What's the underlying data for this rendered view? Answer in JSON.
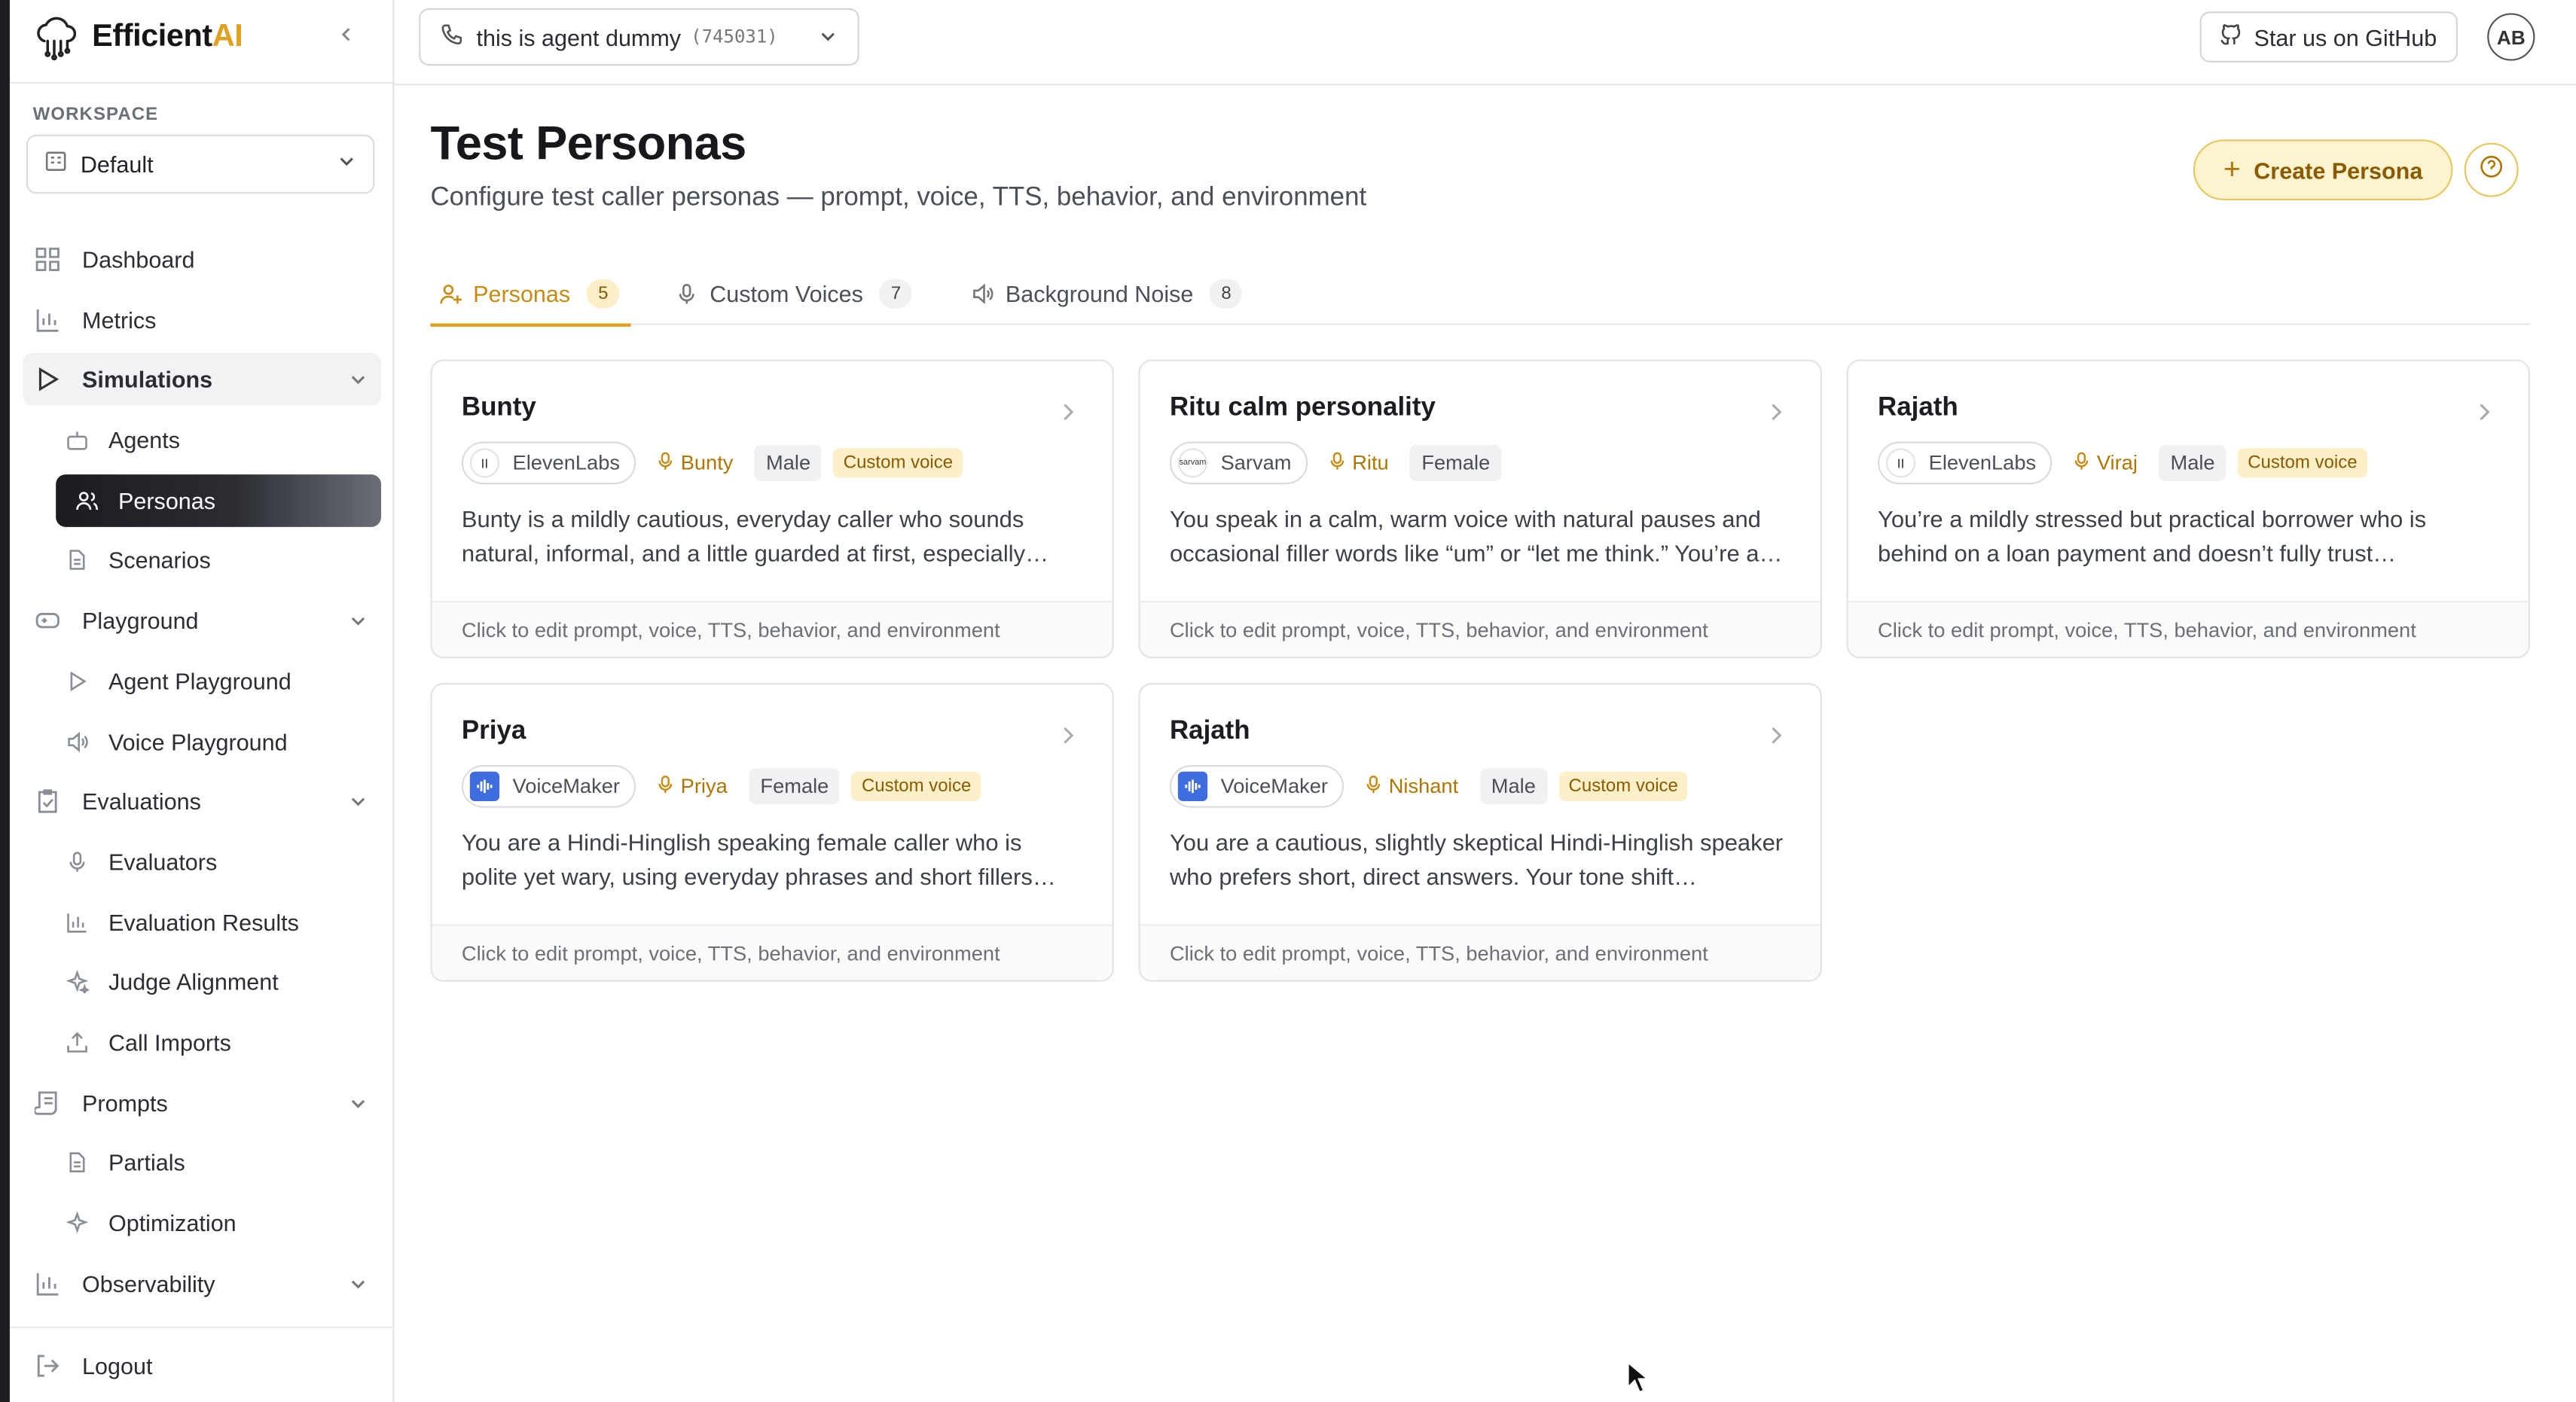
{
  "brand": {
    "name_main": "Efficient",
    "name_accent": "AI"
  },
  "workspace": {
    "label": "WORKSPACE",
    "selected": "Default"
  },
  "sidebar": {
    "items": [
      {
        "label": "Dashboard",
        "icon": "dashboard-icon"
      },
      {
        "label": "Metrics",
        "icon": "bar-chart-icon"
      },
      {
        "label": "Simulations",
        "icon": "play-icon"
      },
      {
        "label": "Agents",
        "icon": "bot-icon"
      },
      {
        "label": "Personas",
        "icon": "users-icon"
      },
      {
        "label": "Scenarios",
        "icon": "file-icon"
      },
      {
        "label": "Playground",
        "icon": "gamepad-icon"
      },
      {
        "label": "Agent Playground",
        "icon": "play-icon"
      },
      {
        "label": "Voice Playground",
        "icon": "speaker-icon"
      },
      {
        "label": "Evaluations",
        "icon": "clipboard-check-icon"
      },
      {
        "label": "Evaluators",
        "icon": "mic-icon"
      },
      {
        "label": "Evaluation Results",
        "icon": "bar-chart-icon"
      },
      {
        "label": "Judge Alignment",
        "icon": "sparkle-icon"
      },
      {
        "label": "Call Imports",
        "icon": "upload-icon"
      },
      {
        "label": "Prompts",
        "icon": "scroll-icon"
      },
      {
        "label": "Partials",
        "icon": "file-icon"
      },
      {
        "label": "Optimization",
        "icon": "sparkle-icon"
      },
      {
        "label": "Observability",
        "icon": "bar-chart-icon"
      }
    ],
    "logout": "Logout"
  },
  "topbar": {
    "agent_name": "this is agent dummy",
    "agent_id": "(745031)",
    "github_label": "Star us on GitHub",
    "avatar_initials": "AB"
  },
  "page": {
    "title": "Test Personas",
    "subtitle": "Configure test caller personas — prompt, voice, TTS, behavior, and environment",
    "create_label": "Create Persona"
  },
  "tabs": [
    {
      "label": "Personas",
      "count": "5"
    },
    {
      "label": "Custom Voices",
      "count": "7"
    },
    {
      "label": "Background Noise",
      "count": "8"
    }
  ],
  "cards": [
    {
      "title": "Bunty",
      "provider": "ElevenLabs",
      "voice": "Bunty",
      "gender": "Male",
      "custom": "Custom voice",
      "desc": "Bunty is a mildly cautious, everyday caller who sounds natural, informal, and a little guarded at first, especially…",
      "footer": "Click to edit prompt, voice, TTS, behavior, and environment"
    },
    {
      "title": "Ritu calm personality",
      "provider": "Sarvam",
      "voice": "Ritu",
      "gender": "Female",
      "custom": "",
      "desc": "You speak in a calm, warm voice with natural pauses and occasional filler words like “um” or “let me think.” You’re a…",
      "footer": "Click to edit prompt, voice, TTS, behavior, and environment"
    },
    {
      "title": "Rajath",
      "provider": "ElevenLabs",
      "voice": "Viraj",
      "gender": "Male",
      "custom": "Custom voice",
      "desc": "You’re a mildly stressed but practical borrower who is behind on a loan payment and doesn’t fully trust…",
      "footer": "Click to edit prompt, voice, TTS, behavior, and environment"
    },
    {
      "title": "Priya",
      "provider": "VoiceMaker",
      "voice": "Priya",
      "gender": "Female",
      "custom": "Custom voice",
      "desc": "You are a Hindi-Hinglish speaking female caller who is polite yet wary, using everyday phrases and short fillers…",
      "footer": "Click to edit prompt, voice, TTS, behavior, and environment"
    },
    {
      "title": "Rajath",
      "provider": "VoiceMaker",
      "voice": "Nishant",
      "gender": "Male",
      "custom": "Custom voice",
      "desc": "You are a cautious, slightly skeptical Hindi-Hinglish speaker who prefers short, direct answers. Your tone shift…",
      "footer": "Click to edit prompt, voice, TTS, behavior, and environment"
    }
  ],
  "provider_logo_text": {
    "sarvam": "sarvam"
  },
  "colors": {
    "accent": "#e0a020",
    "accent_bg": "#fdf0c8",
    "active_nav": "#1b1c20"
  }
}
